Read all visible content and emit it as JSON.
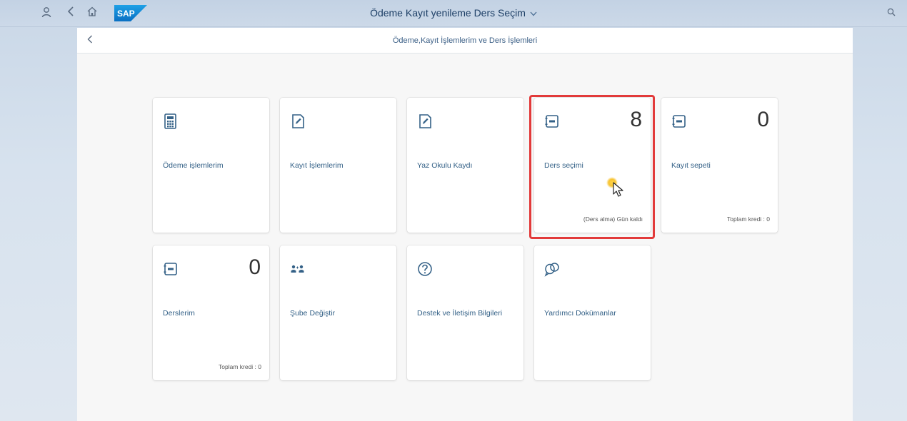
{
  "shell": {
    "title": "Ödeme Kayıt yenileme Ders Seçim",
    "sap_logo_text": "SAP"
  },
  "subheader": {
    "title": "Ödeme,Kayıt İşlemlerim ve Ders İşlemleri"
  },
  "tiles": [
    {
      "title": "Ödeme işlemlerim",
      "icon": "calculator-icon",
      "count": "",
      "footer": ""
    },
    {
      "title": "Kayıt İşlemlerim",
      "icon": "edit-document-icon",
      "count": "",
      "footer": ""
    },
    {
      "title": "Yaz Okulu Kaydı",
      "icon": "edit-document-icon",
      "count": "",
      "footer": ""
    },
    {
      "title": "Ders seçimi",
      "icon": "course-book-icon",
      "count": "8",
      "footer": "(Ders alma) Gün kaldı"
    },
    {
      "title": "Kayıt sepeti",
      "icon": "course-book-icon",
      "count": "0",
      "footer": "Toplam kredi : 0"
    },
    {
      "title": "Derslerim",
      "icon": "course-book-icon",
      "count": "0",
      "footer": "Toplam kredi : 0"
    },
    {
      "title": "Şube Değiştir",
      "icon": "group-icon",
      "count": "",
      "footer": ""
    },
    {
      "title": "Destek ve İletişim Bilgileri",
      "icon": "question-mark-icon",
      "count": "",
      "footer": ""
    },
    {
      "title": "Yardımcı Dokümanlar",
      "icon": "discussion-icon",
      "count": "",
      "footer": ""
    }
  ],
  "colors": {
    "accent": "#346187",
    "highlight": "#e23a3a",
    "shell_bg": "#c3d2e4"
  }
}
